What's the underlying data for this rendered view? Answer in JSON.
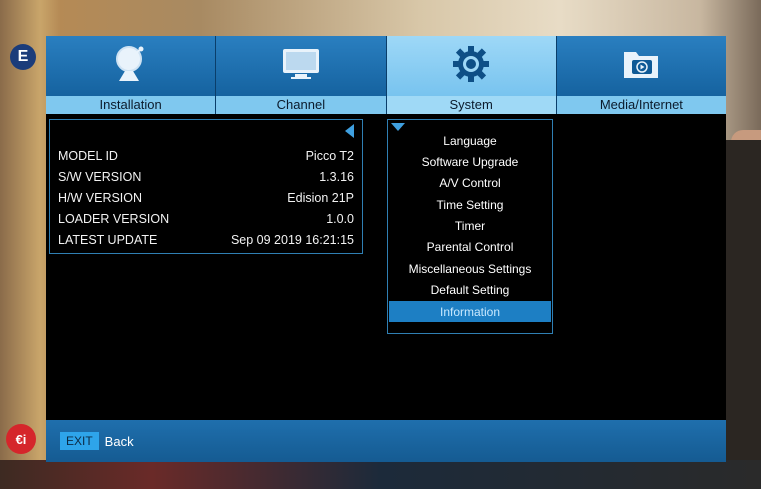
{
  "background": {
    "channel_logo": "E",
    "channel_badge": "€i"
  },
  "tabs": [
    {
      "label": "Installation",
      "icon": "satellite-dish-icon"
    },
    {
      "label": "Channel",
      "icon": "tv-monitor-icon"
    },
    {
      "label": "System",
      "icon": "gear-icon",
      "active": true
    },
    {
      "label": "Media/Internet",
      "icon": "media-folder-icon"
    }
  ],
  "info": {
    "rows": [
      {
        "label": "MODEL ID",
        "value": "Picco T2"
      },
      {
        "label": "S/W VERSION",
        "value": "1.3.16"
      },
      {
        "label": "H/W VERSION",
        "value": "Edision 21P"
      },
      {
        "label": "LOADER VERSION",
        "value": "1.0.0"
      },
      {
        "label": "LATEST UPDATE",
        "value": "Sep 09 2019 16:21:15"
      }
    ]
  },
  "system_menu": {
    "items": [
      "Language",
      "Software Upgrade",
      "A/V Control",
      "Time Setting",
      "Timer",
      "Parental Control",
      "Miscellaneous Settings",
      "Default Setting",
      "Information"
    ],
    "selected": "Information"
  },
  "bottom_bar": {
    "exit_key": "EXIT",
    "exit_label": "Back"
  },
  "colors": {
    "tab_blue": "#0f5a96",
    "tab_active": "#9ed8f7",
    "highlight": "#1d7fc4"
  }
}
